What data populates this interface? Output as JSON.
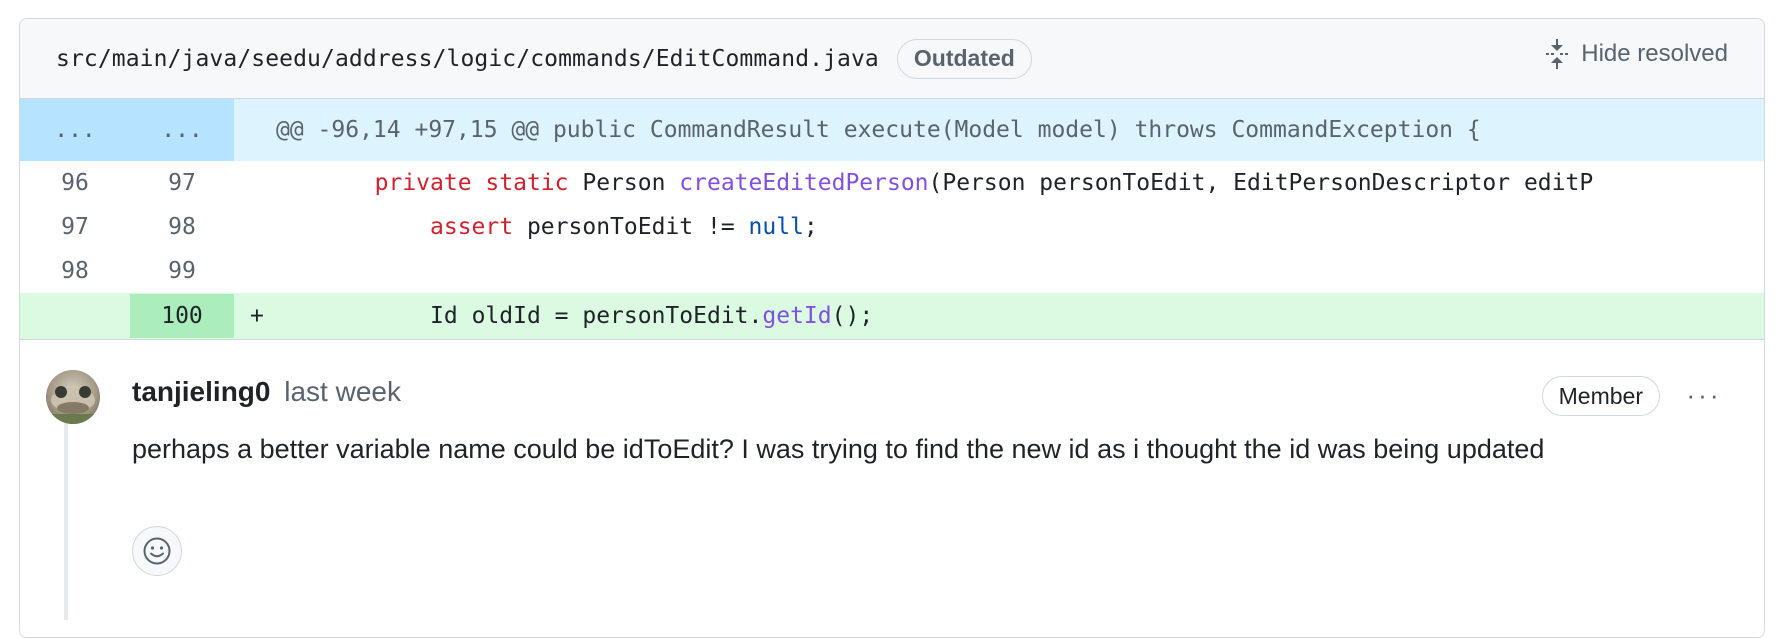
{
  "file": {
    "path": "src/main/java/seedu/address/logic/commands/EditCommand.java",
    "badge": "Outdated",
    "hide_resolved_label": "Hide resolved"
  },
  "diff": {
    "hunk": {
      "old_marker": "...",
      "new_marker": "...",
      "header": "@@ -96,14 +97,15 @@ public CommandResult execute(Model model) throws CommandException {"
    },
    "lines": [
      {
        "old": "96",
        "new": "97"
      },
      {
        "old": "97",
        "new": "98"
      },
      {
        "old": "98",
        "new": "99"
      },
      {
        "old": "",
        "new": "100",
        "prefix": "+"
      }
    ],
    "line1": {
      "kw": "private static",
      "t1": " Person ",
      "fn": "createEditedPerson",
      "t2": "(Person personToEdit, EditPersonDescriptor editP"
    },
    "line2": {
      "kw": "assert",
      "t1": " personToEdit != ",
      "lit": "null",
      "t2": ";"
    },
    "line4": {
      "t1": "Id oldId = personToEdit.",
      "fn": "getId",
      "t2": "();"
    }
  },
  "comment": {
    "author": "tanjieling0",
    "time": "last week",
    "role_badge": "Member",
    "more_label": "···",
    "body": "perhaps a better variable name could be idToEdit? I was trying to find the new id as i thought the id was being updated"
  },
  "colors": {
    "hunk_bg": "#ddf4ff",
    "addition_bg": "#dafbe1",
    "keyword": "#cf222e",
    "function": "#8250df",
    "literal": "#0550ae"
  }
}
